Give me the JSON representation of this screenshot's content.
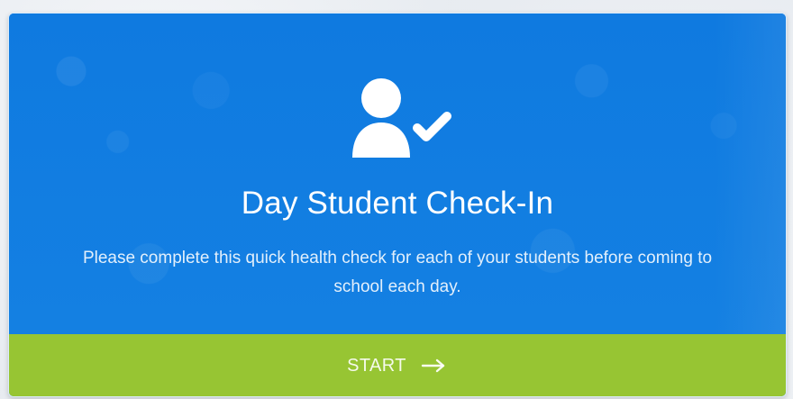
{
  "card": {
    "title": "Day Student Check-In",
    "description": "Please complete this quick health check for each of your students before coming to school each day."
  },
  "actions": {
    "start_label": "START"
  },
  "icons": {
    "hero": "user-check-icon",
    "start": "arrow-right-icon"
  },
  "colors": {
    "primary": "#167fe0",
    "accent": "#97c533",
    "text": "#ffffff"
  }
}
